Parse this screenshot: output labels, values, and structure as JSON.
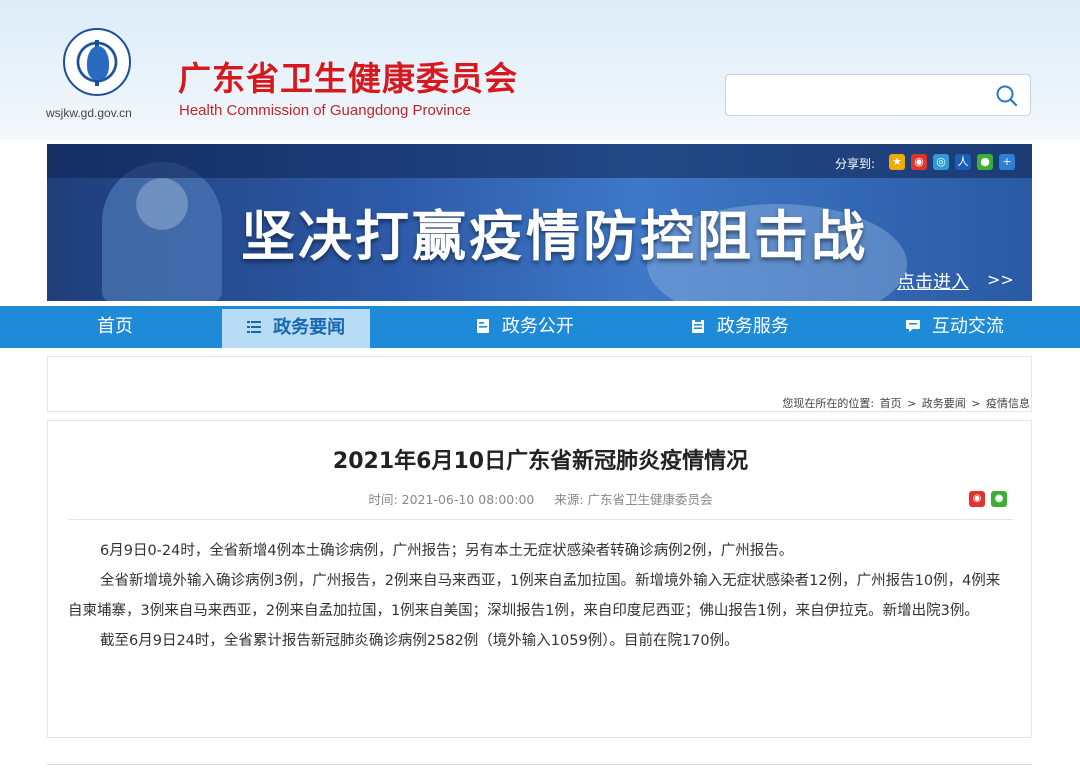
{
  "header": {
    "site_url": "wsjkw.gd.gov.cn",
    "title_cn": "广东省卫生健康委员会",
    "title_en": "Health Commission of Guangdong Province",
    "search": {
      "value": "",
      "placeholder": ""
    }
  },
  "banner": {
    "share_label": "分享到:",
    "title": "坚决打赢疫情防控阻击战",
    "enter_link": "点击进入",
    "enter_arrow": ">>"
  },
  "nav": {
    "items": [
      {
        "label": "首页",
        "icon": "none",
        "active": false
      },
      {
        "label": "政务要闻",
        "icon": "list-icon",
        "active": true
      },
      {
        "label": "政务公开",
        "icon": "document-icon",
        "active": false
      },
      {
        "label": "政务服务",
        "icon": "clipboard-icon",
        "active": false
      },
      {
        "label": "互动交流",
        "icon": "chat-icon",
        "active": false
      }
    ]
  },
  "breadcrumb": {
    "prefix": "您现在所在的位置:",
    "items": [
      "首页",
      "政务要闻",
      "疫情信息"
    ],
    "separator": ">"
  },
  "article": {
    "title": "2021年6月10日广东省新冠肺炎疫情情况",
    "time": "时间: 2021-06-10 08:00:00",
    "source": "来源: 广东省卫生健康委员会",
    "paragraphs": [
      "6月9日0-24时，全省新增4例本土确诊病例，广州报告；另有本土无症状感染者转确诊病例2例，广州报告。",
      "全省新增境外输入确诊病例3例，广州报告，2例来自马来西亚，1例来自孟加拉国。新增境外输入无症状感染者12例，广州报告10例，4例来自柬埔寨，3例来自马来西亚，2例来自孟加拉国，1例来自美国；深圳报告1例，来自印度尼西亚；佛山报告1例，来自伊拉克。新增出院3例。",
      "截至6月9日24时，全省累计报告新冠肺炎确诊病例2582例（境外输入1059例）。目前在院170例。"
    ]
  },
  "colors": {
    "brand_red": "#d7181f",
    "nav_blue": "#1f8ad8",
    "nav_active_bg": "#b8dcf6",
    "banner_blue": "#2d5aa8"
  }
}
